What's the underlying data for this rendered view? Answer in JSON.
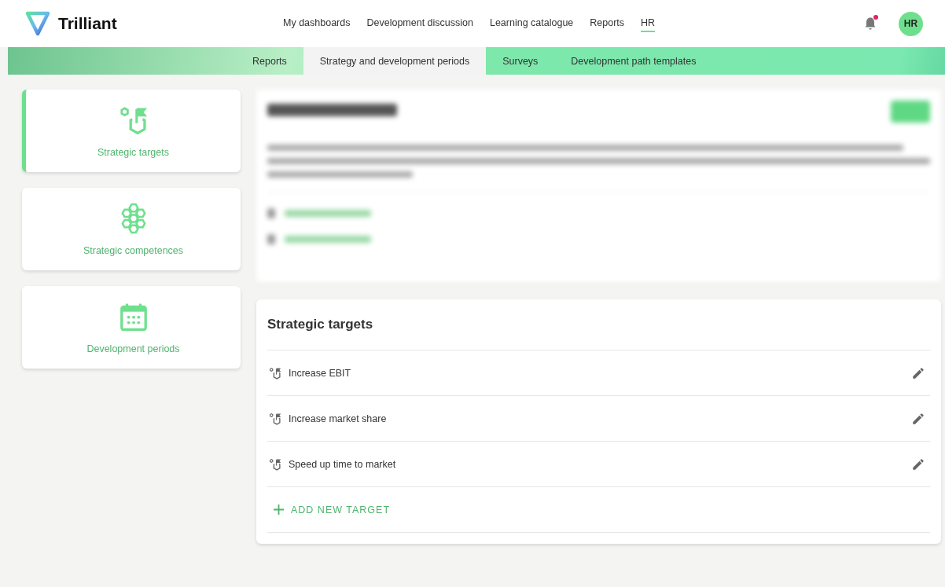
{
  "brand": {
    "name": "Trilliant"
  },
  "nav": [
    {
      "label": "My dashboards",
      "selected": false
    },
    {
      "label": "Development discussion",
      "selected": false
    },
    {
      "label": "Learning catalogue",
      "selected": false
    },
    {
      "label": "Reports",
      "selected": false
    },
    {
      "label": "HR",
      "selected": true
    }
  ],
  "notifications": {
    "unread": true
  },
  "user": {
    "initials": "HR"
  },
  "subnav": [
    {
      "label": "Reports",
      "selected": false
    },
    {
      "label": "Strategy and development periods",
      "selected": true
    },
    {
      "label": "Surveys",
      "selected": false
    },
    {
      "label": "Development path templates",
      "selected": false
    }
  ],
  "sidebar": {
    "items": [
      {
        "label": "Strategic targets",
        "kind": "targets",
        "selected": true
      },
      {
        "label": "Strategic competences",
        "kind": "competences",
        "selected": false
      },
      {
        "label": "Development periods",
        "kind": "periods",
        "selected": false
      }
    ]
  },
  "strategy_panel": {
    "blurred": true
  },
  "targets": {
    "title": "Strategic targets",
    "items": [
      {
        "label": "Increase EBIT"
      },
      {
        "label": "Increase market share"
      },
      {
        "label": "Speed up time to market"
      }
    ],
    "add_label": "ADD NEW TARGET"
  }
}
